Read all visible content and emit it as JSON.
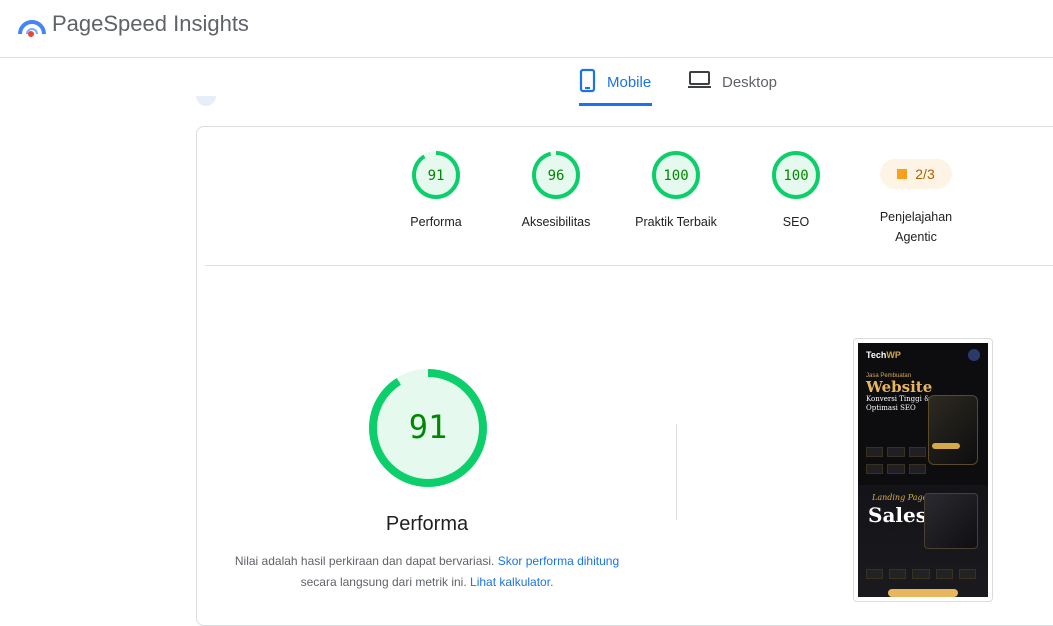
{
  "header": {
    "brand": "PageSpeed Insights"
  },
  "tabs": [
    {
      "label": "Mobile",
      "active": true
    },
    {
      "label": "Desktop",
      "active": false
    }
  ],
  "categories": [
    {
      "label": "Performa",
      "score": 91
    },
    {
      "label": "Aksesibilitas",
      "score": 96
    },
    {
      "label": "Praktik Terbaik",
      "score": 100
    },
    {
      "label": "SEO",
      "score": 100
    },
    {
      "label_line1": "Penjelajahan",
      "label_line2": "Agentic",
      "badge": "2/3"
    }
  ],
  "main": {
    "score": 91,
    "title": "Performa",
    "desc_prefix": "Nilai adalah hasil perkiraan dan dapat bervariasi.",
    "desc_link1": "Skor performa dihitung",
    "desc_mid": "secara langsung dari metrik ini.",
    "desc_link2": "Lihat kalkulator."
  },
  "screenshot": {
    "brand_a": "Tech",
    "brand_b": "WP",
    "small_text": "Jasa Pembuatan",
    "headline": "Website",
    "line1": "Konversi Tinggi &",
    "line2": "Optimasi SEO",
    "script_text": "Landing Page",
    "sales": "Sales"
  },
  "colors": {
    "pass_green": "#0cce6b",
    "pass_text": "#008800",
    "pass_bg": "#e6f9ef",
    "accent_blue": "#1a73e8",
    "average_orange": "#fa9f1e"
  }
}
